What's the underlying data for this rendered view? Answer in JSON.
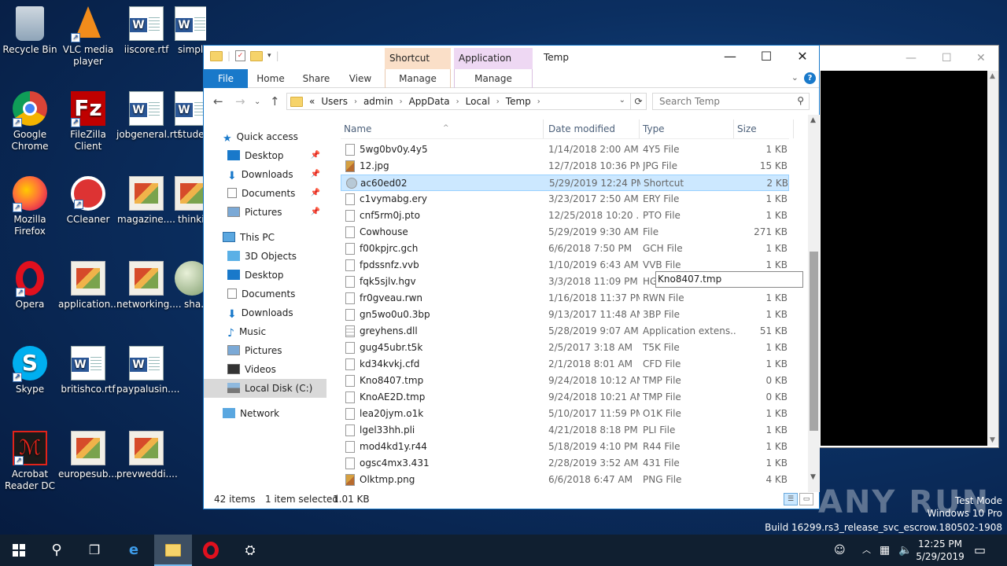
{
  "desktop": {
    "icons": [
      {
        "label": "Recycle Bin",
        "icon": "recycle-bin-icon"
      },
      {
        "label": "VLC media player",
        "icon": "vlc-icon"
      },
      {
        "label": "iiscore.rtf",
        "icon": "word-doc-icon"
      },
      {
        "label": "simpl...",
        "icon": "word-doc-icon"
      },
      {
        "label": "Google Chrome",
        "icon": "chrome-icon"
      },
      {
        "label": "FileZilla Client",
        "icon": "filezilla-icon"
      },
      {
        "label": "jobgeneral.rtf",
        "icon": "word-doc-icon"
      },
      {
        "label": "stude...",
        "icon": "word-doc-icon"
      },
      {
        "label": "Mozilla Firefox",
        "icon": "firefox-icon"
      },
      {
        "label": "CCleaner",
        "icon": "ccleaner-icon"
      },
      {
        "label": "magazine....",
        "icon": "image-file-icon"
      },
      {
        "label": "thinki...",
        "icon": "image-file-icon"
      },
      {
        "label": "Opera",
        "icon": "opera-icon"
      },
      {
        "label": "application....",
        "icon": "image-file-icon"
      },
      {
        "label": "networking....",
        "icon": "image-file-icon"
      },
      {
        "label": "sha...",
        "icon": "globe-icon"
      },
      {
        "label": "Skype",
        "icon": "skype-icon"
      },
      {
        "label": "britishco.rtf",
        "icon": "word-doc-icon"
      },
      {
        "label": "paypalusin....",
        "icon": "word-doc-icon"
      },
      {
        "label": "Acrobat Reader DC",
        "icon": "acrobat-icon"
      },
      {
        "label": "europesub....",
        "icon": "image-file-icon"
      },
      {
        "label": "prevweddi....",
        "icon": "image-file-icon"
      }
    ]
  },
  "explorer": {
    "title": "Temp",
    "context_tabs": {
      "shortcut_tools": "Shortcut Tools",
      "application_tools": "Application Tools"
    },
    "ribbon_tabs": {
      "file": "File",
      "home": "Home",
      "share": "Share",
      "view": "View",
      "manage1": "Manage",
      "manage2": "Manage"
    },
    "address": {
      "prefix": "«",
      "crumbs": [
        "Users",
        "admin",
        "AppData",
        "Local",
        "Temp"
      ]
    },
    "search_placeholder": "Search Temp",
    "nav": {
      "quick_access": "Quick access",
      "qa_desktop": "Desktop",
      "qa_downloads": "Downloads",
      "qa_documents": "Documents",
      "qa_pictures": "Pictures",
      "this_pc": "This PC",
      "objects3d": "3D Objects",
      "desktop": "Desktop",
      "documents": "Documents",
      "downloads": "Downloads",
      "music": "Music",
      "pictures": "Pictures",
      "videos": "Videos",
      "local_disk": "Local Disk (C:)",
      "network": "Network"
    },
    "columns": {
      "name": "Name",
      "date": "Date modified",
      "type": "Type",
      "size": "Size"
    },
    "files": [
      {
        "name": "5wg0bv0y.4y5",
        "date": "1/14/2018 2:00 AM",
        "type": "4Y5 File",
        "size": "1 KB",
        "icon": "file"
      },
      {
        "name": "12.jpg",
        "date": "12/7/2018 10:36 PM",
        "type": "JPG File",
        "size": "15 KB",
        "icon": "img"
      },
      {
        "name": "ac60ed02",
        "date": "5/29/2019 12:24 PM",
        "type": "Shortcut",
        "size": "2 KB",
        "icon": "lnk"
      },
      {
        "name": "c1vymabg.ery",
        "date": "3/23/2017 2:50 AM",
        "type": "ERY File",
        "size": "1 KB",
        "icon": "file"
      },
      {
        "name": "cnf5rm0j.pto",
        "date": "12/25/2018 10:20 ...",
        "type": "PTO File",
        "size": "1 KB",
        "icon": "file"
      },
      {
        "name": "Cowhouse",
        "date": "5/29/2019 9:30 AM",
        "type": "File",
        "size": "271 KB",
        "icon": "file"
      },
      {
        "name": "f00kpjrc.gch",
        "date": "6/6/2018 7:50 PM",
        "type": "GCH File",
        "size": "1 KB",
        "icon": "file"
      },
      {
        "name": "fpdssnfz.vvb",
        "date": "1/10/2019 6:43 AM",
        "type": "VVB File",
        "size": "1 KB",
        "icon": "file"
      },
      {
        "name": "fqk5sjlv.hgv",
        "date": "3/3/2018 11:09 PM",
        "type": "HG",
        "size": "",
        "icon": "file"
      },
      {
        "name": "fr0gveau.rwn",
        "date": "1/16/2018 11:37 PM",
        "type": "RWN File",
        "size": "1 KB",
        "icon": "file"
      },
      {
        "name": "gn5wo0u0.3bp",
        "date": "9/13/2017 11:48 AM",
        "type": "3BP File",
        "size": "1 KB",
        "icon": "file"
      },
      {
        "name": "greyhens.dll",
        "date": "5/28/2019 9:07 AM",
        "type": "Application extens...",
        "size": "51 KB",
        "icon": "dll"
      },
      {
        "name": "gug45ubr.t5k",
        "date": "2/5/2017 3:18 AM",
        "type": "T5K File",
        "size": "1 KB",
        "icon": "file"
      },
      {
        "name": "kd34kvkj.cfd",
        "date": "2/1/2018 8:01 AM",
        "type": "CFD File",
        "size": "1 KB",
        "icon": "file"
      },
      {
        "name": "Kno8407.tmp",
        "date": "9/24/2018 10:12 AM",
        "type": "TMP File",
        "size": "0 KB",
        "icon": "file"
      },
      {
        "name": "KnoAE2D.tmp",
        "date": "9/24/2018 10:21 AM",
        "type": "TMP File",
        "size": "0 KB",
        "icon": "file"
      },
      {
        "name": "lea20jym.o1k",
        "date": "5/10/2017 11:59 PM",
        "type": "O1K File",
        "size": "1 KB",
        "icon": "file"
      },
      {
        "name": "lgel33hh.pli",
        "date": "4/21/2018 8:18 PM",
        "type": "PLI File",
        "size": "1 KB",
        "icon": "file"
      },
      {
        "name": "mod4kd1y.r44",
        "date": "5/18/2019 4:10 PM",
        "type": "R44 File",
        "size": "1 KB",
        "icon": "file"
      },
      {
        "name": "ogsc4mx3.431",
        "date": "2/28/2019 3:52 AM",
        "type": "431 File",
        "size": "1 KB",
        "icon": "file"
      },
      {
        "name": "Olktmp.png",
        "date": "6/6/2018 6:47 AM",
        "type": "PNG File",
        "size": "4 KB",
        "icon": "img"
      }
    ],
    "rename_value": "Kno8407.tmp",
    "status": {
      "items": "42 items",
      "selected": "1 item selected",
      "size": "1.01 KB"
    }
  },
  "watermark": {
    "brand": "ANY RUN",
    "mode": "Test Mode",
    "os": "Windows 10 Pro",
    "build": "Build 16299.rs3_release_svc_escrow.180502-1908"
  },
  "taskbar": {
    "time": "12:25 PM",
    "date": "5/29/2019"
  }
}
